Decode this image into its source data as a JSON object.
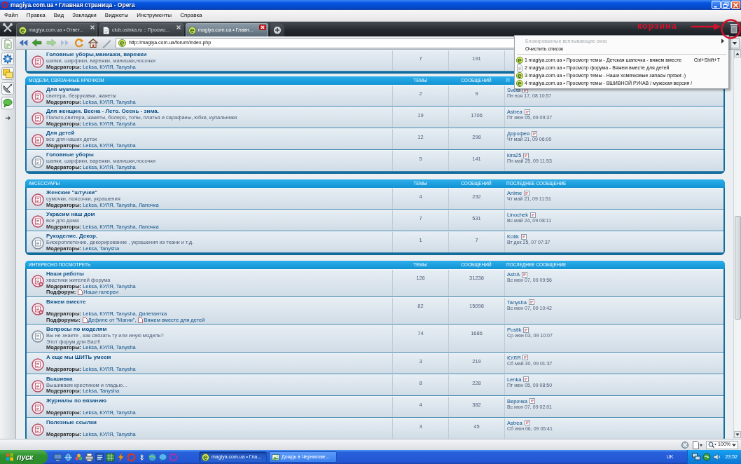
{
  "window": {
    "title": "magiya.com.ua • Главная страница - Opera"
  },
  "menu": [
    "Файл",
    "Правка",
    "Вид",
    "Закладки",
    "Виджеты",
    "Инструменты",
    "Справка"
  ],
  "tabs": [
    {
      "label": "magiya.com.ua • Ответ...",
      "kind": "site",
      "selected": false
    },
    {
      "label": "club.osinka.ru :: Просмо...",
      "kind": "page",
      "selected": false
    },
    {
      "label": "magiya.com.ua • Главн...",
      "kind": "site",
      "selected": true
    }
  ],
  "annotation": {
    "text": "корзина"
  },
  "address_bar": {
    "value": "http://magiya.com.ua/forum/index.php"
  },
  "popup_menu": [
    {
      "kind": "submenu",
      "label": "Блокированные всплывающие окна",
      "disabled": true
    },
    {
      "kind": "action",
      "label": "Очистить список",
      "disabled": false
    },
    {
      "kind": "site",
      "label": "1 magiya.com.ua • Просмотр темы - Детская шапочка - вяжем вместе",
      "shortcut": "Ctrl+Shift+T",
      "disabled": false
    },
    {
      "kind": "page",
      "label": "2 magiya.com.ua • Просмотр форума - Вяжем вместе для детей",
      "disabled": false
    },
    {
      "kind": "site",
      "label": "3 magiya.com.ua • Просмотр темы - Наши хомячковые запасы пряжи:-)",
      "disabled": false
    },
    {
      "kind": "site",
      "label": "4 magiya.com.ua • Просмотр темы - ВШИВНОЙ РУКАВ / мужская версия /",
      "disabled": false
    }
  ],
  "forum": {
    "scrolled_block": {
      "forums": [
        {
          "title": "Головные уборы,манишки, варежки",
          "description": "шапки, шарфики, варежки, манишки,носочки",
          "moderators": "**Модераторы:** Leksa, КУЛЯ, Tanysha",
          "topics": "7",
          "posts": "191",
          "new_posts": true
        }
      ]
    },
    "categories": [
      {
        "title": "МОДЕЛИ, СВЯЗАННЫЕ КРЮЧКОМ",
        "columns": [
          "ТЕМЫ",
          "СООБЩЕНИЙ",
          "П"
        ],
        "forums": [
          {
            "title": "Для мужчин",
            "description": "свитера, безрукавки, жакеты",
            "moderators": "**Модераторы:** Leksa, КУЛЯ, Tanysha",
            "topics": "2",
            "posts": "9",
            "new_posts": true,
            "last_post": {
              "author": "Sveta",
              "time": "Пн ноя 17, 08 10:57"
            }
          },
          {
            "title": "Для женщин. Весна - Лето. Осень - зима.",
            "description": "Пальто,свитера, жакеты, болеро, топы, платья и сарафаны, юбки, купальники",
            "moderators": "**Модераторы:** Leksa, КУЛЯ, Tanysha",
            "topics": "19",
            "posts": "1706",
            "new_posts": true,
            "last_post": {
              "author": "Astrea",
              "time": "Пт июн 05, 09 09:37"
            }
          },
          {
            "title": "Для детей",
            "description": "все для наших деток",
            "moderators": "**Модераторы:** Leksa, КУЛЯ, Tanysha",
            "topics": "12",
            "posts": "298",
            "new_posts": true,
            "last_post": {
              "author": "Дорофея",
              "time": "Чт май 21, 09 06:00"
            }
          },
          {
            "title": "Головные уборы",
            "description": "шапки, шарфики, варежки, манишки,носочки",
            "moderators": "**Модераторы:** Leksa, КУЛЯ, Tanysha",
            "topics": "5",
            "posts": "141",
            "new_posts": false,
            "last_post": {
              "author": "kira25",
              "time": "Пн май 25, 09 11:53"
            }
          }
        ]
      },
      {
        "title": "АКСЕССУАРЫ",
        "columns": [
          "ТЕМЫ",
          "СООБЩЕНИЙ",
          "ПОСЛЕДНЕЕ СООБЩЕНИЕ"
        ],
        "forums": [
          {
            "title": "Женские \"штучки\"",
            "description": "сумочки, поясочки, украшения",
            "moderators": "**Модераторы:** Leksa, КУЛЯ, Tanysha, Лапочка",
            "topics": "4",
            "posts": "232",
            "new_posts": true,
            "last_post": {
              "author": "Anime",
              "time": "Чт май 21, 09 11:51"
            }
          },
          {
            "title": "Украсим наш дом",
            "description": "все для дома",
            "moderators": "**Модераторы:** Leksa, КУЛЯ, Tanysha, Лапочка",
            "topics": "7",
            "posts": "531",
            "new_posts": true,
            "last_post": {
              "author": "Linochek",
              "time": "Вс май 24, 09 08:11"
            }
          },
          {
            "title": "Рукоделие. Декор.",
            "description": "Бисероплетение, декорирование , украшения из ткани и т.д.",
            "moderators": "**Модераторы:** Leksa, Tanysha",
            "topics": "1",
            "posts": "7",
            "new_posts": false,
            "last_post": {
              "author": "Kotik",
              "time": "Вт дек 25, 07 07:37"
            }
          }
        ]
      },
      {
        "title": "ИНТЕРЕСНО ПОСМОТРЕТЬ",
        "columns": [
          "ТЕМЫ",
          "СООБЩЕНИЙ",
          "ПОСЛЕДНЕЕ СООБЩЕНИЕ"
        ],
        "forums": [
          {
            "title": "Наши работы",
            "description": "хвастики жителей форума",
            "moderators": "**Модераторы:** Leksa, КУЛЯ, Tanysha",
            "subforums": {
              "label": "Подфорум:",
              "links": [
                "Наши галереи"
              ]
            },
            "topics": "126",
            "posts": "31238",
            "new_posts": true,
            "last_post": {
              "author": "AstrA",
              "time": "Вс июн 07, 09 09:56"
            }
          },
          {
            "title": "Вяжем вместе",
            "moderators": "**Модераторы:** Leksa, КУЛЯ, Tanysha, Дилетантка",
            "subforums": {
              "label": "Подфорумы:",
              "links": [
                "Дефиле от \"Магии\",",
                "Вяжем вместе для детей"
              ]
            },
            "topics": "82",
            "posts": "15098",
            "new_posts": true,
            "last_post": {
              "author": "Tanysha",
              "time": "Вс июн 07, 09 10:42"
            }
          },
          {
            "title": "Вопросы по моделям",
            "description": "Вы не знаете , как связать ту или иную модель?\nЭтот форум для Вас!!!",
            "moderators": "**Модераторы:** Leksa, КУЛЯ, Tanysha",
            "topics": "74",
            "posts": "1686",
            "new_posts": false,
            "last_post": {
              "author": "Pustik",
              "time": "Ср июн 03, 09 10:07"
            }
          },
          {
            "title": "А еще мы ШИТЬ умеем",
            "moderators": "**Модераторы:** Leksa, КУЛЯ, Tanysha",
            "topics": "3",
            "posts": "219",
            "new_posts": true,
            "last_post": {
              "author": "КУЛЯ",
              "time": "Сб май 30, 09 01:37"
            }
          },
          {
            "title": "Вышивка",
            "description": "Вышиваем крестиком и гладью...",
            "moderators": "**Модераторы:** Leksa, Tanysha",
            "topics": "8",
            "posts": "228",
            "new_posts": true,
            "last_post": {
              "author": "Lenka",
              "time": "Пт июн 05, 09 08:50"
            }
          },
          {
            "title": "Журналы по вязанию",
            "moderators": "**Модераторы:** Leksa, КУЛЯ, Tanysha",
            "topics": "4",
            "posts": "382",
            "new_posts": true,
            "last_post": {
              "author": "Верочка",
              "time": "Вс июн 07, 09 02:01"
            }
          },
          {
            "title": "Полезные ссылки",
            "moderators": "**Модераторы:** Leksa, КУЛЯ, Tanysha",
            "topics": "3",
            "posts": "45",
            "new_posts": true,
            "last_post": {
              "author": "Astrea",
              "time": "Сб июн 06, 09 05:41"
            }
          }
        ]
      }
    ]
  },
  "status_bar": {
    "zoom": "100%"
  },
  "taskbar": {
    "start": "пуск",
    "tasks": [
      {
        "label": "magiya.com.ua • Гла...",
        "kind": "browser",
        "selected": true
      },
      {
        "label": "Дождь в Чернигове...",
        "kind": "viewer",
        "selected": false
      }
    ],
    "language": "UK",
    "clock": "23:52"
  }
}
